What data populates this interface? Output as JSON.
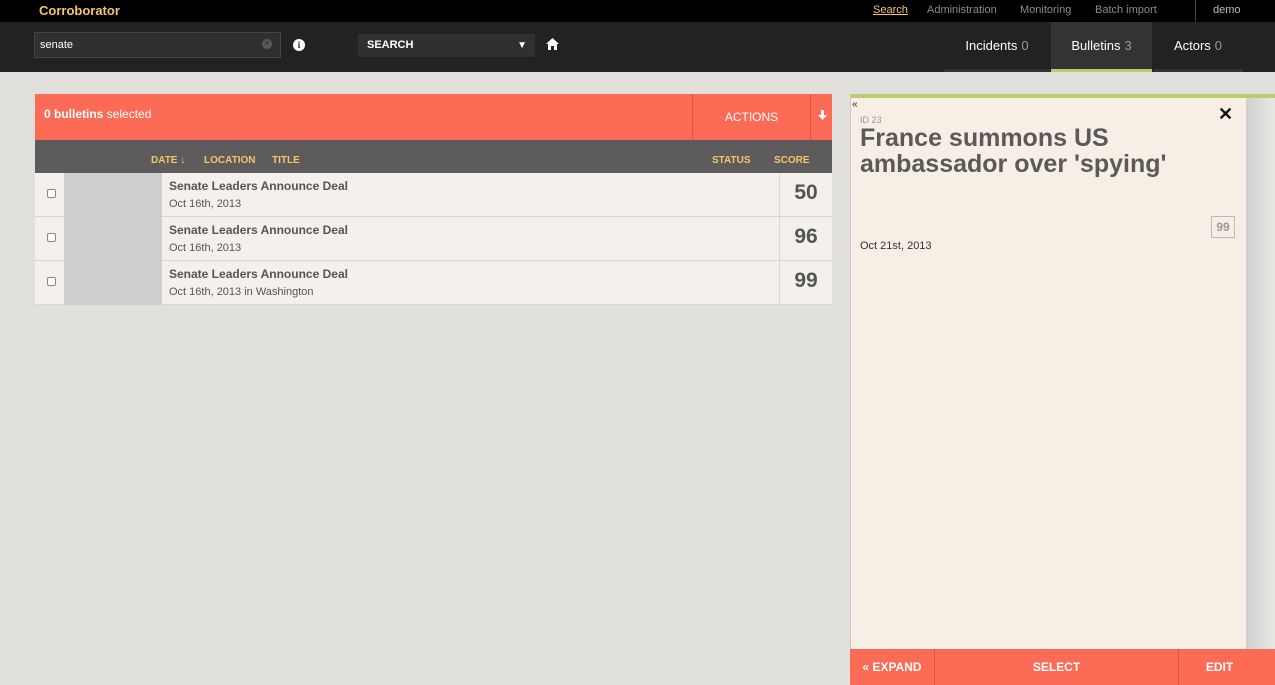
{
  "app": {
    "brand": "Corroborator",
    "user": "demo"
  },
  "topnav": [
    {
      "label": "Search"
    },
    {
      "label": "Administration"
    },
    {
      "label": "Monitoring"
    },
    {
      "label": "Batch import"
    }
  ],
  "search": {
    "value": "senate",
    "select_label": "SEARCH"
  },
  "tabs": [
    {
      "label": "Incidents",
      "count": "0"
    },
    {
      "label": "Bulletins",
      "count": "3"
    },
    {
      "label": "Actors",
      "count": "0"
    }
  ],
  "actions": {
    "selected_count": "0 bulletins",
    "selected_suffix": " selected",
    "actions_label": "ACTIONS"
  },
  "columns": {
    "date": "DATE",
    "location": "LOCATION",
    "title": "TITLE",
    "status": "STATUS",
    "score": "SCORE"
  },
  "rows": [
    {
      "title": "Senate Leaders Announce Deal",
      "date": "Oct 16th, 2013",
      "score": "50"
    },
    {
      "title": "Senate Leaders Announce Deal",
      "date": "Oct 16th, 2013",
      "score": "96"
    },
    {
      "title": "Senate Leaders Announce Deal",
      "date": "Oct 16th, 2013 in Washington",
      "score": "99"
    }
  ],
  "detail": {
    "id": "ID 23",
    "title": "France summons US ambassador over 'spying'",
    "score": "99",
    "date": "Oct 21st, 2013",
    "expand_label": "« EXPAND",
    "select_label": "SELECT",
    "edit_label": "EDIT"
  },
  "colors": {
    "accent": "#fc6b56",
    "highlight": "#f5c56b",
    "tab_active": "#b6cf6e"
  }
}
